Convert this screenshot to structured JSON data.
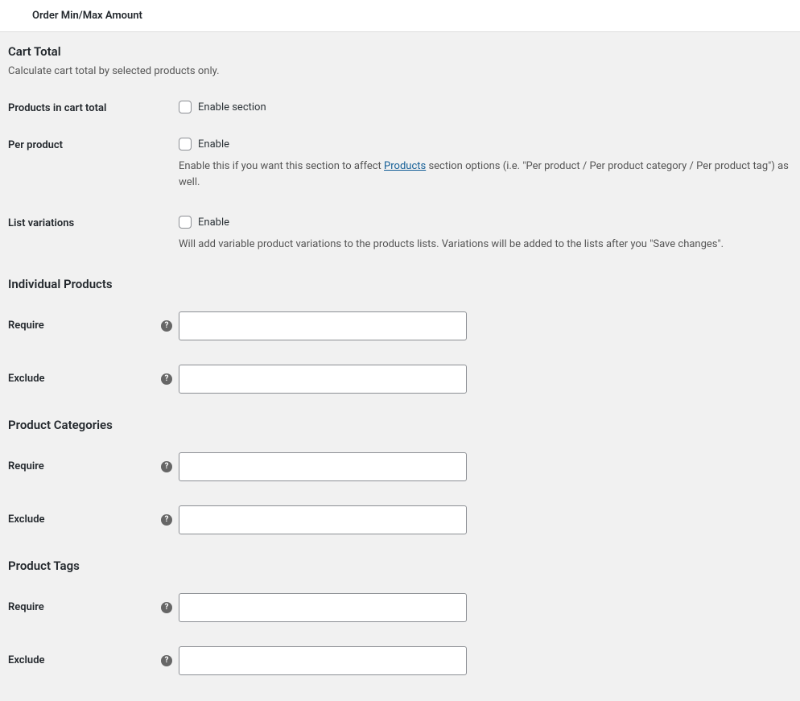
{
  "topBar": {
    "title": "Order Min/Max Amount"
  },
  "sections": {
    "cartTotal": {
      "heading": "Cart Total",
      "description": "Calculate cart total by selected products only.",
      "productsInCart": {
        "label": "Products in cart total",
        "checkboxLabel": "Enable section"
      },
      "perProduct": {
        "label": "Per product",
        "checkboxLabel": "Enable",
        "descPrefix": "Enable this if you want this section to affect ",
        "descLink": "Products",
        "descSuffix": " section options (i.e. \"Per product / Per product category / Per product tag\") as well."
      },
      "listVariations": {
        "label": "List variations",
        "checkboxLabel": "Enable",
        "description": "Will add variable product variations to the products lists. Variations will be added to the lists after you \"Save changes\"."
      }
    },
    "individualProducts": {
      "heading": "Individual Products",
      "require": {
        "label": "Require"
      },
      "exclude": {
        "label": "Exclude"
      }
    },
    "productCategories": {
      "heading": "Product Categories",
      "require": {
        "label": "Require"
      },
      "exclude": {
        "label": "Exclude"
      }
    },
    "productTags": {
      "heading": "Product Tags",
      "require": {
        "label": "Require"
      },
      "exclude": {
        "label": "Exclude"
      }
    }
  },
  "helpGlyph": "?"
}
